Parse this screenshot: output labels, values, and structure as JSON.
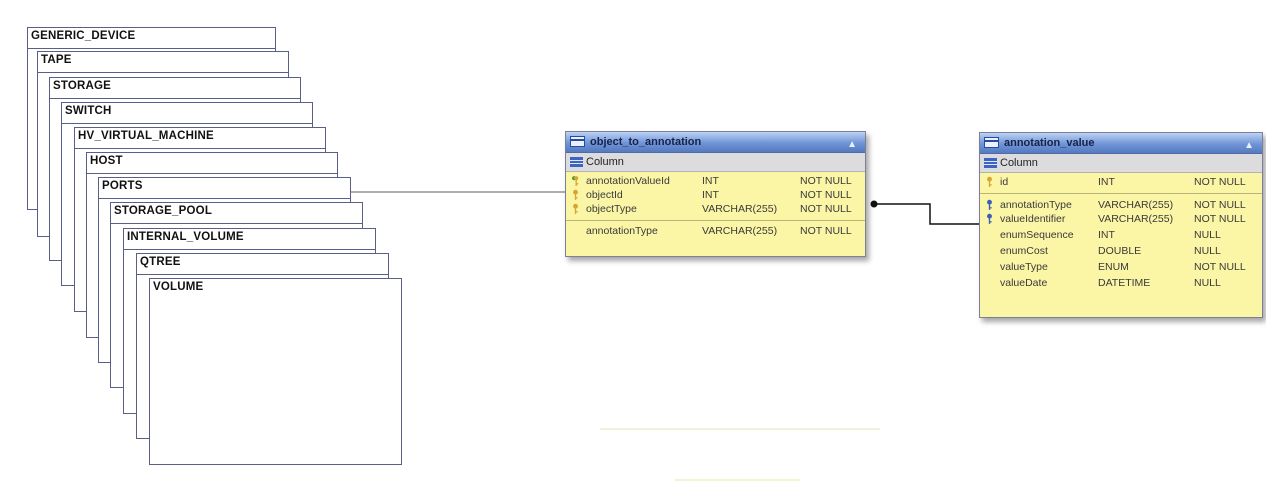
{
  "cards": [
    {
      "label": "GENERIC_DEVICE"
    },
    {
      "label": "TAPE"
    },
    {
      "label": "STORAGE"
    },
    {
      "label": "SWITCH"
    },
    {
      "label": "HV_VIRTUAL_MACHINE"
    },
    {
      "label": "HOST"
    },
    {
      "label": "PORTS"
    },
    {
      "label": "STORAGE_POOL"
    },
    {
      "label": "INTERNAL_VOLUME"
    },
    {
      "label": "QTREE"
    },
    {
      "label": "VOLUME"
    }
  ],
  "entity1": {
    "title": "object_to_annotation",
    "subheader": "Column",
    "collapse_glyph": "▲",
    "rows": [
      {
        "name": "annotationValueId",
        "type": "INT",
        "null": "NOT NULL",
        "key": "gold-green"
      },
      {
        "name": "objectId",
        "type": "INT",
        "null": "NOT NULL",
        "key": "gold"
      },
      {
        "name": "objectType",
        "type": "VARCHAR(255)",
        "null": "NOT NULL",
        "key": "gold"
      },
      {
        "name": "annotationType",
        "type": "VARCHAR(255)",
        "null": "NOT NULL",
        "key": ""
      }
    ]
  },
  "entity2": {
    "title": "annotation_value",
    "subheader": "Column",
    "collapse_glyph": "▲",
    "rows": [
      {
        "name": "id",
        "type": "INT",
        "null": "NOT NULL",
        "key": "gold"
      },
      {
        "name": "annotationType",
        "type": "VARCHAR(255)",
        "null": "NOT NULL",
        "key": "blue"
      },
      {
        "name": "valueIdentifier",
        "type": "VARCHAR(255)",
        "null": "NOT NULL",
        "key": "blue"
      },
      {
        "name": "enumSequence",
        "type": "INT",
        "null": "NULL",
        "key": ""
      },
      {
        "name": "enumCost",
        "type": "DOUBLE",
        "null": "NULL",
        "key": ""
      },
      {
        "name": "valueType",
        "type": "ENUM",
        "null": "NOT NULL",
        "key": ""
      },
      {
        "name": "valueDate",
        "type": "DATETIME",
        "null": "NULL",
        "key": ""
      }
    ]
  },
  "colors": {
    "card_border": "#5a5f86",
    "entity_body": "#fbf5a6",
    "header_blue": "#6f95d6",
    "gold_key": "#d8a632",
    "green_key": "#4a9a3a",
    "blue_key": "#3d5fb8"
  }
}
